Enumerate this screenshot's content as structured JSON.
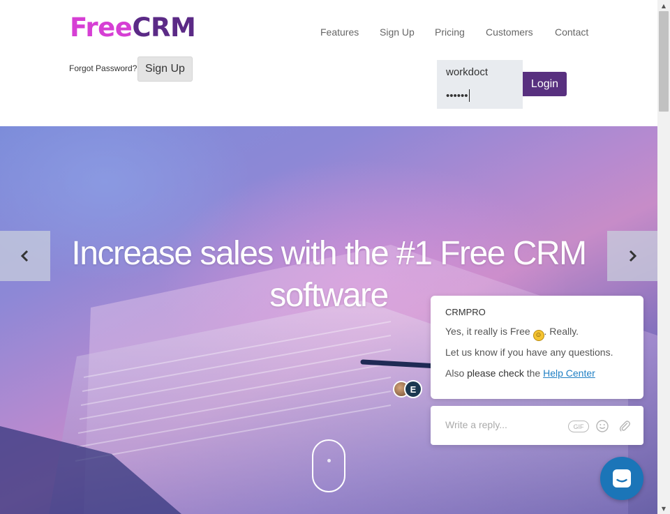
{
  "header": {
    "logo_free": "Free",
    "logo_crm": "CRM",
    "nav": [
      "Features",
      "Sign Up",
      "Pricing",
      "Customers",
      "Contact"
    ],
    "forgot_password": "Forgot Password?",
    "signup_button": "Sign Up",
    "login": {
      "username_value": "workdoct",
      "password_mask": "••••••",
      "button": "Login"
    }
  },
  "hero": {
    "title": "Increase sales with the #1 Free CRM software"
  },
  "chat": {
    "from": "CRMPRO",
    "line1_before": "Yes, it really is Free",
    "line1_after": ".  Really.",
    "line2": "Let us know if you have any questions.",
    "line3_prefix": "Also",
    "line3_bold": "please check",
    "line3_the": "the",
    "help_link": "Help Center",
    "avatar_letter": "E",
    "reply_placeholder": "Write a reply...",
    "gif_label": "GIF"
  },
  "colors": {
    "logo_free": "#d63fd4",
    "logo_crm": "#5b2a86",
    "login_button": "#58307f",
    "launcher": "#1b75b8",
    "link": "#1f7fc4"
  }
}
